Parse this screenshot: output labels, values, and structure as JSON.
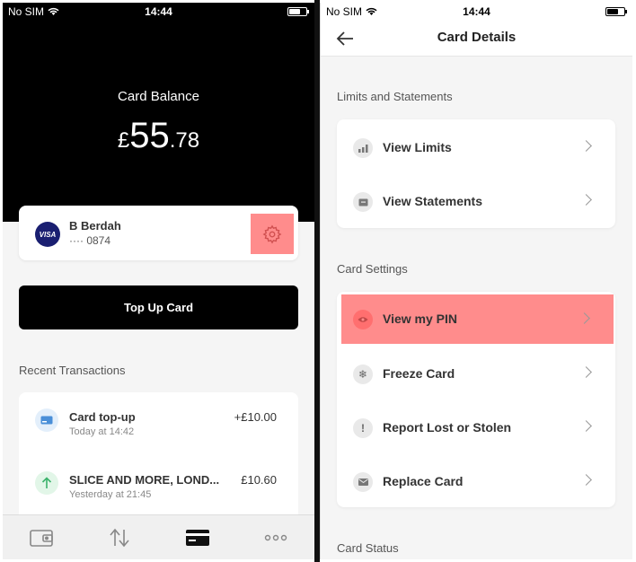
{
  "left": {
    "status": {
      "carrier": "No SIM",
      "time": "14:44"
    },
    "balance": {
      "label": "Card Balance",
      "currency": "£",
      "main": "55",
      "decimals": ".78"
    },
    "card": {
      "name": "B Berdah",
      "number": "···· 0874",
      "brand": "VISA"
    },
    "topup_label": "Top Up Card",
    "recent_title": "Recent Transactions",
    "transactions": [
      {
        "title": "Card top-up",
        "subtitle": "Today at 14:42",
        "amount": "+£10.00"
      },
      {
        "title": "SLICE AND MORE, LOND...",
        "subtitle": "Yesterday at 21:45",
        "amount": "£10.60"
      }
    ],
    "tabs": [
      "wallet-icon",
      "transfer-icon",
      "card-icon",
      "more-icon"
    ]
  },
  "right": {
    "status": {
      "carrier": "No SIM",
      "time": "14:44"
    },
    "title": "Card Details",
    "sections": [
      {
        "title": "Limits and Statements",
        "items": [
          "View Limits",
          "View Statements"
        ]
      },
      {
        "title": "Card Settings",
        "items": [
          "View my PIN",
          "Freeze Card",
          "Report Lost or Stolen",
          "Replace Card"
        ]
      },
      {
        "title": "Card Status"
      }
    ]
  },
  "colors": {
    "highlight": "#ff8c8c",
    "dark": "#000000",
    "background": "#f5f5f5"
  }
}
